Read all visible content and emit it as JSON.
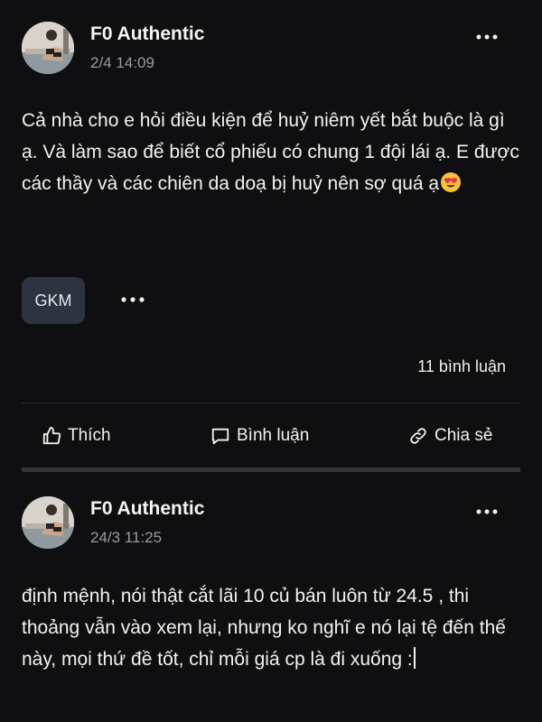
{
  "posts": [
    {
      "author": "F0 Authentic",
      "timestamp": "2/4 14:09",
      "content": "Cả nhà cho e hỏi điều kiện để huỷ niêm yết bắt buộc là gì ạ. Và làm sao để biết cổ phiếu có chung 1 đội lái ạ. E được các thầy và các chiên da doạ bị huỷ nên sợ quá ạ",
      "tag": "GKM",
      "comment_count": "11 bình luận",
      "actions": {
        "like": "Thích",
        "comment": "Bình luận",
        "share": "Chia sẻ"
      }
    },
    {
      "author": "F0 Authentic",
      "timestamp": "24/3 11:25",
      "content": "định mệnh, nói thật cắt lãi 10 củ bán luôn từ 24.5 , thi thoảng vẫn vào xem lại, nhưng ko nghĩ e nó lại tệ đến thế này, mọi thứ đề tốt, chỉ mỗi giá cp là đi xuống :"
    }
  ],
  "icons": {
    "more": "more-horizontal-icon",
    "like": "thumbs-up-icon",
    "comment": "comment-icon",
    "share": "link-icon",
    "emoji": "heart-eyes-emoji"
  },
  "colors": {
    "background": "#0f0f11",
    "muted": "#9a9aa0",
    "tag_bg": "#2d3340"
  }
}
